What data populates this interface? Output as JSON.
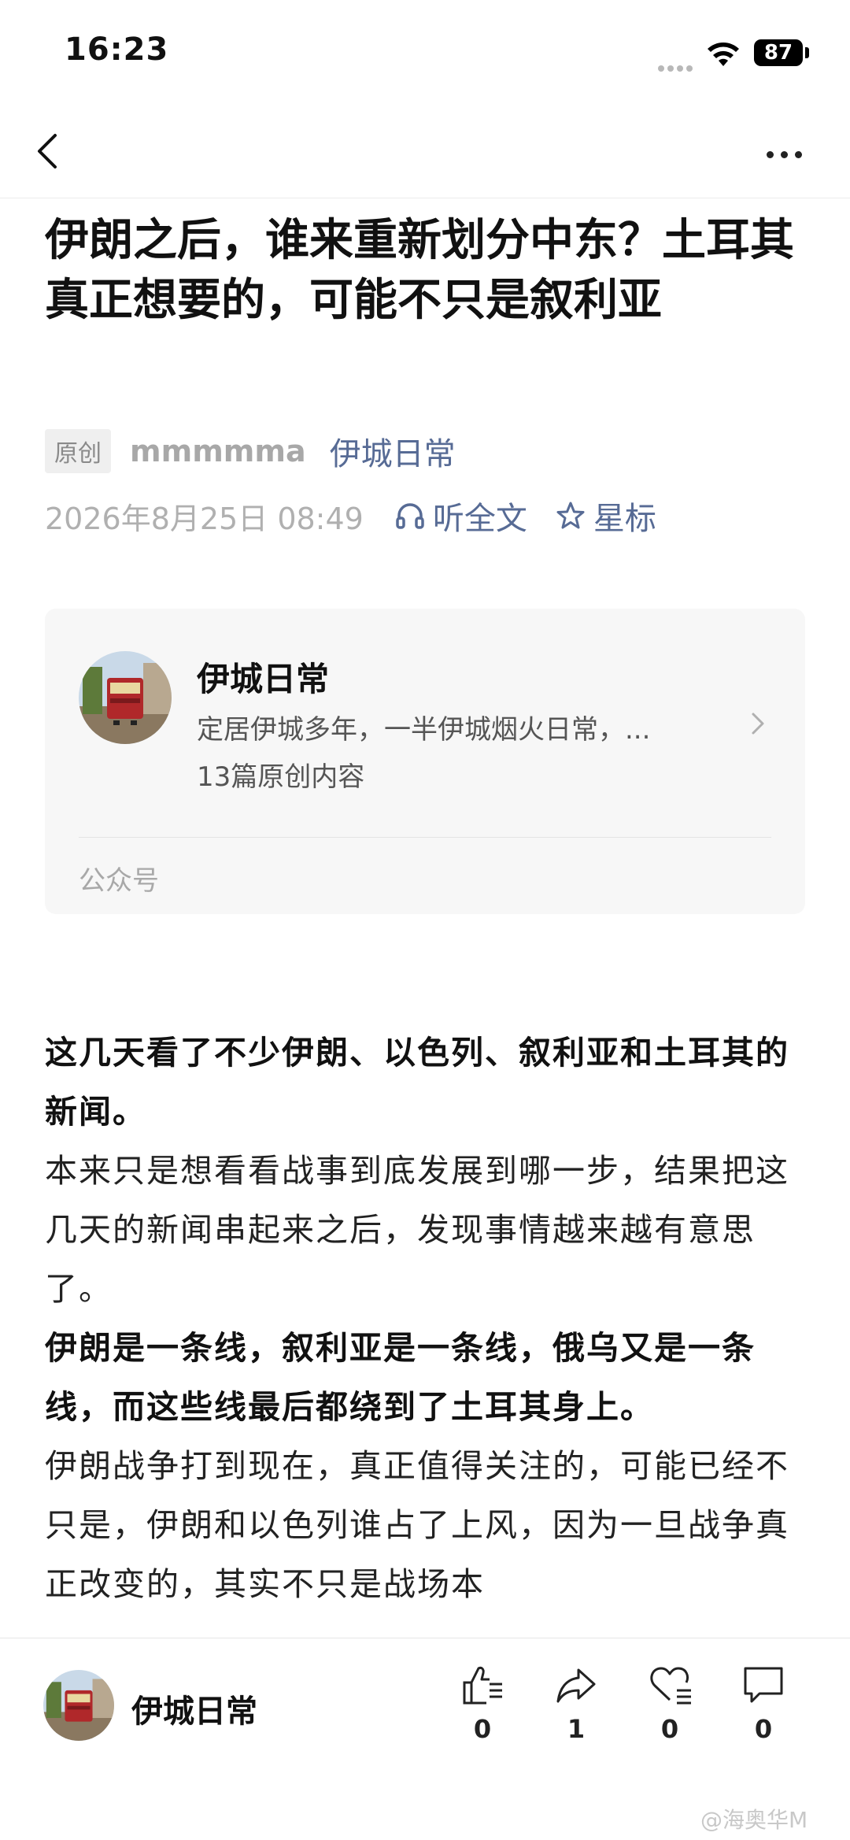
{
  "status_bar": {
    "time": "16:23",
    "battery": "87"
  },
  "nav": {
    "back_icon": "chevron-left-icon",
    "more_icon": "more-dots-icon"
  },
  "article": {
    "title": "伊朗之后，谁来重新划分中东？土耳其真正想要的，可能不只是叙利亚",
    "original_tag": "原创",
    "author": "mmmmma",
    "account": "伊城日常",
    "date": "2026年8月25日 08:49",
    "listen_label": "听全文",
    "star_label": "星标"
  },
  "account_card": {
    "name": "伊城日常",
    "description": "定居伊城多年，一半伊城烟火日常，...",
    "article_count": "13篇原创内容",
    "type_label": "公众号"
  },
  "body": {
    "p1": "这几天看了不少伊朗、以色列、叙利亚和土耳其的新闻。",
    "p2": "本来只是想看看战事到底发展到哪一步，结果把这几天的新闻串起来之后，发现事情越来越有意思了。",
    "p3": "伊朗是一条线，叙利亚是一条线，俄乌又是一条线，而这些线最后都绕到了土耳其身上。",
    "p4": " 伊朗战争打到现在，真正值得关注的，可能已经不只是，伊朗和以色列谁占了上风，因为一旦战争真正改变的，其实不只是战场本"
  },
  "bottom_bar": {
    "account_name": "伊城日常",
    "like_count": "0",
    "share_count": "1",
    "favorite_count": "0",
    "comment_count": "0"
  },
  "watermark": "@海奥华M",
  "colors": {
    "link": "#576b95",
    "muted": "#a8a8a8",
    "card_bg": "#f7f7f7"
  }
}
